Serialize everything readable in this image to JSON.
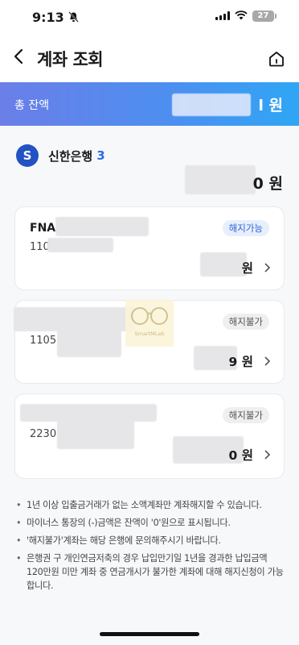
{
  "status": {
    "time": "9:13",
    "battery": "27"
  },
  "header": {
    "title": "계좌 조회"
  },
  "total": {
    "label": "총 잔액",
    "value_suffix": "l 원"
  },
  "bank": {
    "logo_letter": "S",
    "name": "신한은행",
    "count": "3",
    "total_suffix": "0 원"
  },
  "accounts": [
    {
      "name": "FNA",
      "number": "110",
      "badge": "해지가능",
      "amount": "원"
    },
    {
      "name": "",
      "number": "1105",
      "badge": "해지불가",
      "amount": "9 원"
    },
    {
      "name": "",
      "number": "2230",
      "badge": "해지불가",
      "amount": "0 원"
    }
  ],
  "watermark": "SmartMLab",
  "notes": [
    "1년 이상 입출금거래가 없는 소액계좌만 계좌해지할 수 있습니다.",
    "마이너스 통장의 (-)금액은 잔액이 '0'원으로 표시됩니다.",
    "'해지불가'계좌는 해당 은행에 문의해주시기 바랍니다.",
    "은행권 구 개인연금저축의 경우 납입만기일 1년을 경과한 납입금액 120만원 미만 계좌 중 연금개시가 불가한 계좌에 대해 해지신청이 가능합니다."
  ]
}
